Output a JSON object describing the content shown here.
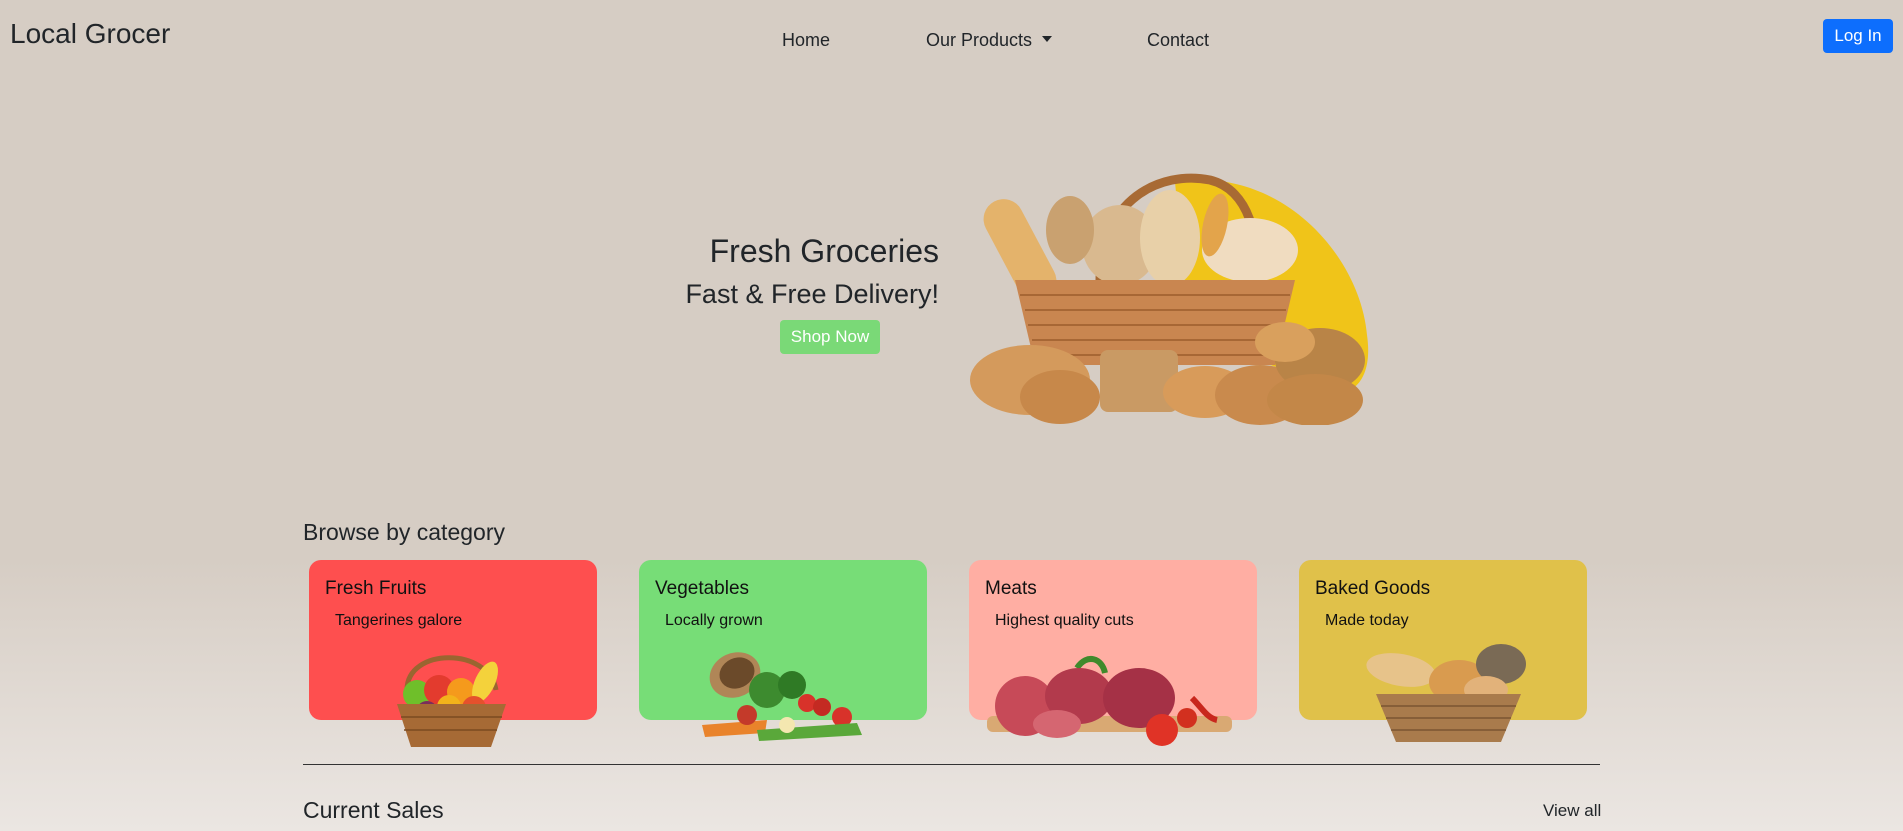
{
  "nav": {
    "brand": "Local Grocer",
    "links": [
      {
        "label": "Home"
      },
      {
        "label": "Our Products",
        "has_dropdown": true
      },
      {
        "label": "Contact"
      }
    ],
    "login_label": "Log In"
  },
  "hero": {
    "title": "Fresh Groceries",
    "subtitle": "Fast & Free Delivery!",
    "cta_label": "Shop Now",
    "image": "bread-basket-image"
  },
  "browse": {
    "heading": "Browse by category",
    "categories": [
      {
        "title": "Fresh Fruits",
        "description": "Tangerines galore",
        "color": "#fe4f4f",
        "image": "fruit-basket-image"
      },
      {
        "title": "Vegetables",
        "description": "Locally grown",
        "color": "#77dd77",
        "image": "vegetables-image"
      },
      {
        "title": "Meats",
        "description": "Highest quality cuts",
        "color": "#ffaea3",
        "image": "meat-cuts-image"
      },
      {
        "title": "Baked Goods",
        "description": "Made today",
        "color": "#e0c14a",
        "image": "bread-basket-image"
      }
    ]
  },
  "sales": {
    "heading": "Current Sales",
    "view_all_label": "View all"
  },
  "colors": {
    "login_button": "#0d6efd",
    "shop_button": "#7ad977",
    "hero_accent": "#f0c419"
  }
}
